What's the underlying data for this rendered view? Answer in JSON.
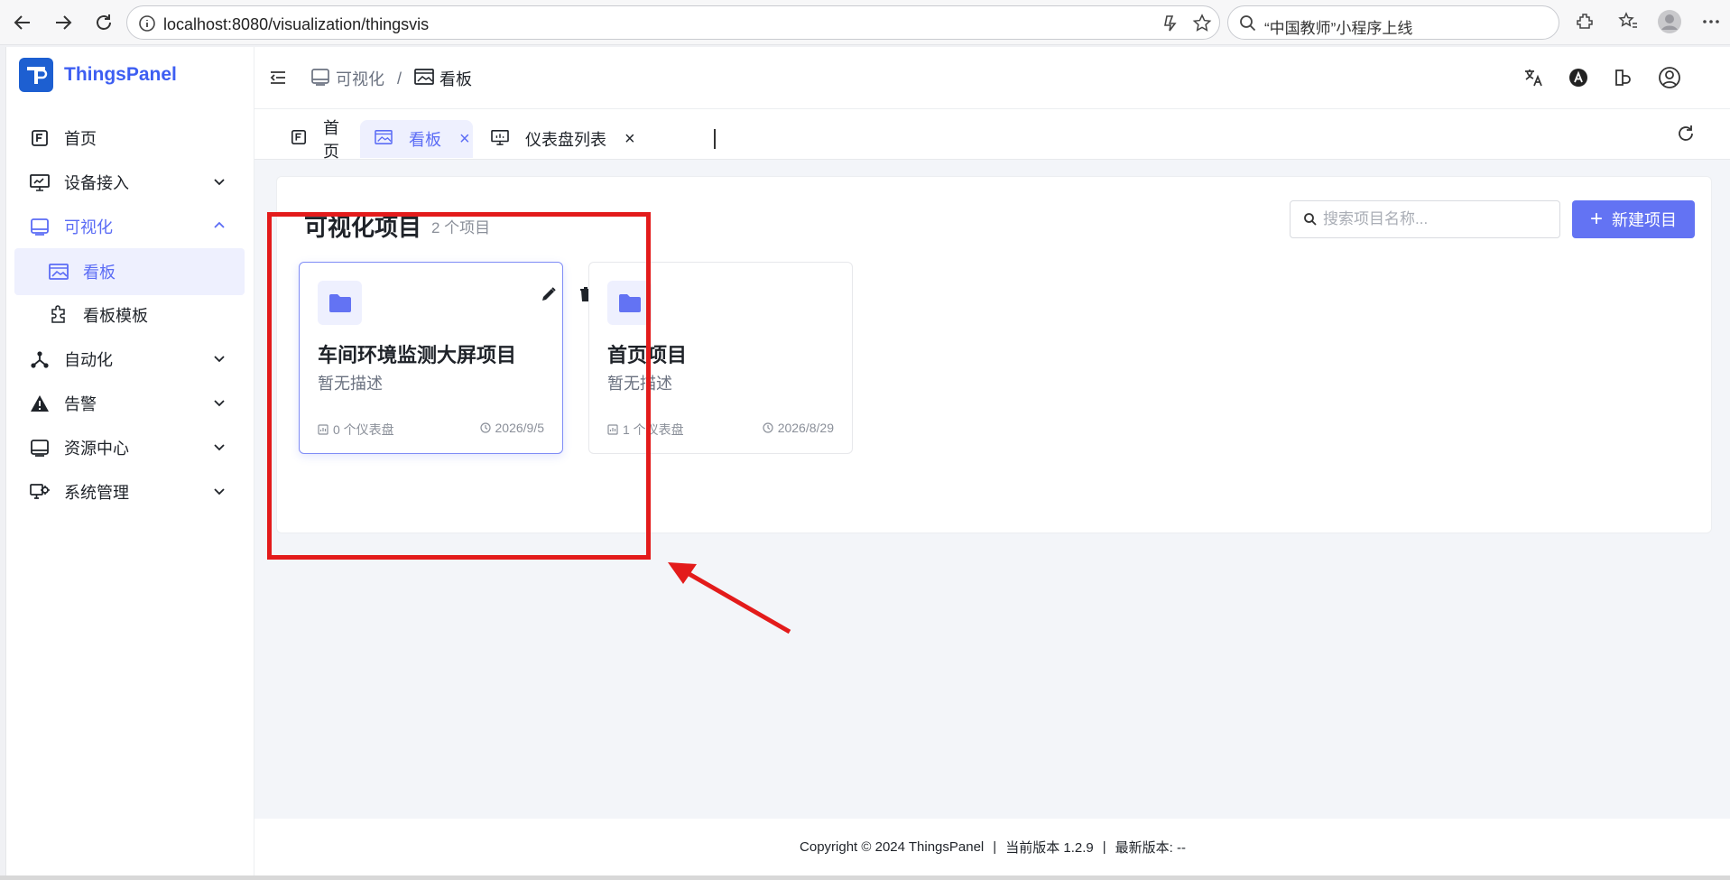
{
  "browser": {
    "url": "localhost:8080/visualization/thingsvis",
    "search_query": "“中国教师”小程序上线"
  },
  "app": {
    "logo_text": "ThingsPanel"
  },
  "sidebar": {
    "items": [
      {
        "label": "首页"
      },
      {
        "label": "设备接入"
      },
      {
        "label": "可视化"
      },
      {
        "label": "看板"
      },
      {
        "label": "看板模板"
      },
      {
        "label": "自动化"
      },
      {
        "label": "告警"
      },
      {
        "label": "资源中心"
      },
      {
        "label": "系统管理"
      }
    ]
  },
  "header": {
    "breadcrumb": [
      {
        "label": "可视化"
      },
      {
        "label": "看板"
      }
    ],
    "separator": "/"
  },
  "tabs": [
    {
      "label": "首页"
    },
    {
      "label": "看板",
      "close": "×"
    },
    {
      "label": "仪表盘列表",
      "close": "×"
    }
  ],
  "main": {
    "title": "可视化项目",
    "count": "2 个项目",
    "search_placeholder": "搜索项目名称...",
    "new_button": "新建项目",
    "new_button_icon": "+"
  },
  "projects": [
    {
      "name": "车间环境监测大屏项目",
      "description": "暂无描述",
      "dashboards": "0 个仪表盘",
      "date": "2026/9/5"
    },
    {
      "name": "首页项目",
      "description": "暂无描述",
      "dashboards": "1 个仪表盘",
      "date": "2026/8/29"
    }
  ],
  "footer": {
    "copyright": "Copyright © 2024 ThingsPanel",
    "divider": "|",
    "version": "当前版本 1.2.9",
    "latest": "最新版本: --"
  },
  "colors": {
    "accent": "#6373f3",
    "brand_text": "#3d5ef2",
    "logo_bg": "#1d5fd1",
    "annotation": "#e31b1b"
  }
}
